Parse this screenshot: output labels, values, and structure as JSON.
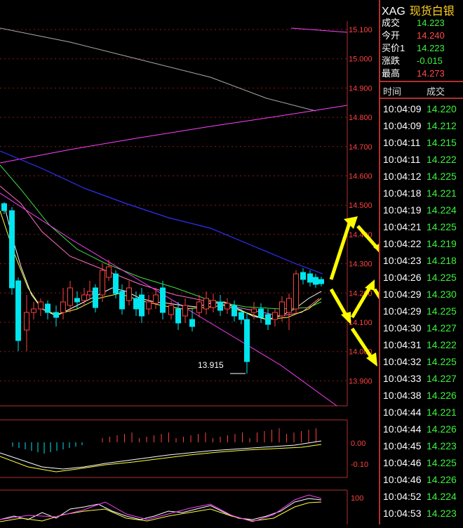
{
  "header": {
    "symbol": "XAG",
    "name": "现货白银"
  },
  "quote": [
    {
      "label": "成交",
      "value": "14.223",
      "tone": "down"
    },
    {
      "label": "今开",
      "value": "14.240",
      "tone": "up"
    },
    {
      "label": "买价1",
      "value": "14.223",
      "tone": "down"
    },
    {
      "label": "涨跌",
      "value": "-0.015",
      "tone": "down"
    },
    {
      "label": "最高",
      "value": "14.273",
      "tone": "up"
    }
  ],
  "ticks_header": {
    "time": "时间",
    "price": "成交"
  },
  "ticks": [
    {
      "time": "10:04:09",
      "price": "14.220"
    },
    {
      "time": "10:04:09",
      "price": "14.212"
    },
    {
      "time": "10:04:11",
      "price": "14.215"
    },
    {
      "time": "10:04:11",
      "price": "14.222"
    },
    {
      "time": "10:04:12",
      "price": "14.225"
    },
    {
      "time": "10:04:18",
      "price": "14.221"
    },
    {
      "time": "10:04:19",
      "price": "14.224"
    },
    {
      "time": "10:04:21",
      "price": "14.225"
    },
    {
      "time": "10:04:22",
      "price": "14.219"
    },
    {
      "time": "10:04:23",
      "price": "14.218"
    },
    {
      "time": "10:04:26",
      "price": "14.225"
    },
    {
      "time": "10:04:29",
      "price": "14.230"
    },
    {
      "time": "10:04:29",
      "price": "14.225"
    },
    {
      "time": "10:04:30",
      "price": "14.227"
    },
    {
      "time": "10:04:31",
      "price": "14.222"
    },
    {
      "time": "10:04:32",
      "price": "14.225"
    },
    {
      "time": "10:04:33",
      "price": "14.227"
    },
    {
      "time": "10:04:38",
      "price": "14.226"
    },
    {
      "time": "10:04:44",
      "price": "14.221"
    },
    {
      "time": "10:04:44",
      "price": "14.226"
    },
    {
      "time": "10:04:45",
      "price": "14.223"
    },
    {
      "time": "10:04:46",
      "price": "14.225"
    },
    {
      "time": "10:04:46",
      "price": "14.226"
    },
    {
      "time": "10:04:52",
      "price": "14.224"
    },
    {
      "time": "10:04:53",
      "price": "14.223"
    }
  ],
  "price_axis": [
    "15.100",
    "15.000",
    "14.900",
    "14.800",
    "14.700",
    "14.600",
    "14.500",
    "14.400",
    "14.300",
    "14.200",
    "14.100",
    "14.000",
    "13.900"
  ],
  "low_marker": "13.915",
  "macd_axis": [
    "0.00",
    "-0.10"
  ],
  "kdj_axis": [
    "100"
  ],
  "colors": {
    "up": "#ff4a4a",
    "down": "#3cf23c",
    "candle_up": "#ff4040",
    "candle_down": "#00e5ee",
    "arrow": "#ffff00"
  },
  "icons": [
    "arrow-annotation"
  ]
}
